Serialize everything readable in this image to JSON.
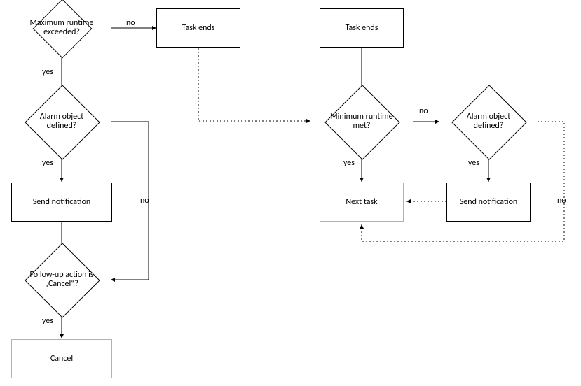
{
  "left": {
    "maxRuntime": "Maximum runtime exceeded?",
    "taskEnds": "Task ends",
    "alarmDefined": "Alarm object defined?",
    "sendNotification": "Send notification",
    "followUp": "Follow-up action is „Cancel“?",
    "cancel": "Cancel"
  },
  "right": {
    "taskEnds": "Task ends",
    "minRuntime": "Minimum runtime met?",
    "alarmDefined": "Alarm object defined?",
    "nextTask": "Next task",
    "sendNotification": "Send notification"
  },
  "labels": {
    "yes": "yes",
    "no": "no"
  }
}
